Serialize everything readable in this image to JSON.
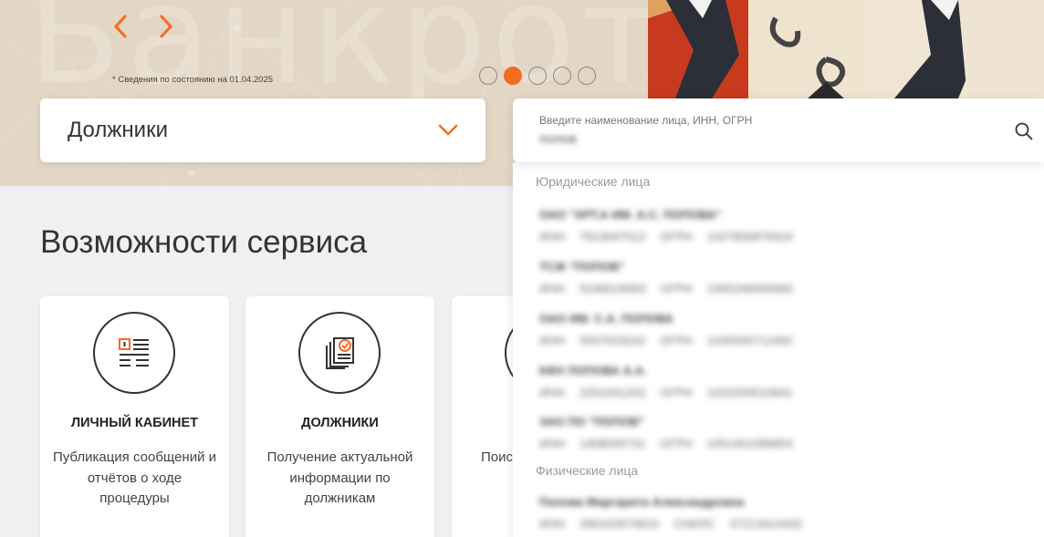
{
  "banner": {
    "watermark": "Банкротство",
    "info_note": "* Сведения по состоянию на 01.04.2025",
    "slides_count": 5,
    "active_slide": 2,
    "accent_color": "#f36c21"
  },
  "category_select": {
    "selected": "Должники"
  },
  "search": {
    "placeholder": "Введите наименование лица, ИНН, ОГРН",
    "value": "попов"
  },
  "results": {
    "legal_title": "Юридические лица",
    "legal": [
      {
        "name": "ОАО \"ХРТ.А ИМ. А.С. ПОПОВА\"",
        "inn_label": "ИНН",
        "inn": "7813047012",
        "ogrn_label": "ОГРН",
        "ogrn": "1027806879319"
      },
      {
        "name": "ТСЖ \"ПОПОВ\"",
        "inn_label": "ИНН",
        "inn": "5246019083",
        "ogrn_label": "ОГРН",
        "ogrn": "1065246000083"
      },
      {
        "name": "ОАО ИМ. С.А. ПОПОВА",
        "inn_label": "ИНН",
        "inn": "5507023242",
        "ogrn_label": "ОГРН",
        "ogrn": "1045500712492"
      },
      {
        "name": "КФХ ПОПОВА А.А.",
        "inn_label": "ИНН",
        "inn": "2201001202",
        "ogrn_label": "ОГРН",
        "ogrn": "1022200510641"
      },
      {
        "name": "ЗАО ПО \"ПОПОВ\"",
        "inn_label": "ИНН",
        "inn": "1408005731",
        "ogrn_label": "ОГРН",
        "ogrn": "1051401089854"
      }
    ],
    "person_title": "Физические лица",
    "persons": [
      {
        "name": "Попова Маргарита Александровна",
        "inn_label": "ИНН",
        "inn": "390102874810",
        "ogrn_label": "СНИЛС",
        "ogrn": "07213414432"
      }
    ]
  },
  "section": {
    "title": "Возможности сервиса"
  },
  "cards": [
    {
      "title": "ЛИЧНЫЙ КАБИНЕТ",
      "desc": "Публикация сообщений и отчётов о ходе процедуры",
      "icon": "info-list-icon"
    },
    {
      "title": "ДОЛЖНИКИ",
      "desc": "Получение актуальной информации по должникам",
      "icon": "document-check-icon"
    },
    {
      "title": "",
      "desc": "Поис выст",
      "icon": "circle-icon"
    }
  ]
}
